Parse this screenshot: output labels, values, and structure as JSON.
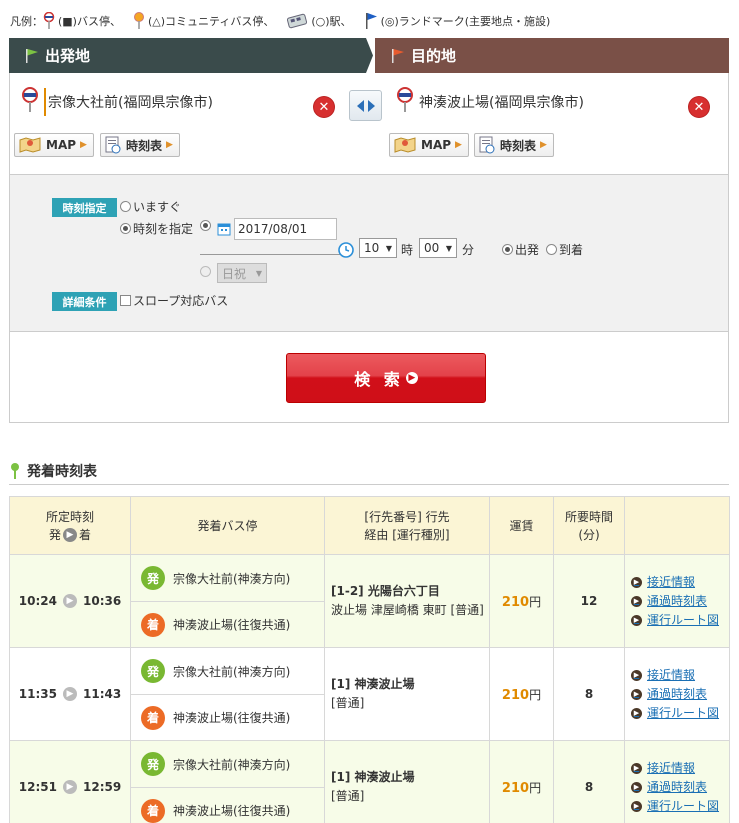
{
  "legend": {
    "prefix": "凡例：",
    "items": [
      {
        "label": "(■)バス停、",
        "icon": "bus-stop-icon"
      },
      {
        "label": "(△)コミュニティバス停、",
        "icon": "community-bus-stop-icon"
      },
      {
        "label": "(○)駅、",
        "icon": "station-icon"
      },
      {
        "label": "(◎)ランドマーク(主要地点・施設)",
        "icon": "landmark-flag-icon"
      }
    ]
  },
  "departure": {
    "header": "出発地",
    "stop_name": "宗像大社前(福岡県宗像市)",
    "map_label": "MAP",
    "timetable_label": "時刻表"
  },
  "arrival": {
    "header": "目的地",
    "stop_name": "神湊波止場(福岡県宗像市)",
    "map_label": "MAP",
    "timetable_label": "時刻表"
  },
  "options": {
    "time_tag": "時刻指定",
    "now_label": "いますぐ",
    "specify_label": "時刻を指定",
    "date_value": "2017/08/01",
    "hour_value": "10",
    "hour_unit": "時",
    "minute_value": "00",
    "minute_unit": "分",
    "depart_label": "出発",
    "arrive_label": "到着",
    "daytype_value": "日祝",
    "detail_tag": "詳細条件",
    "slope_label": "スロープ対応バス"
  },
  "search": {
    "label": "検 索"
  },
  "timetable": {
    "section_title": "発着時刻表",
    "headers": {
      "time_line1": "所定時刻",
      "time_dep": "発",
      "time_arr": "着",
      "stops": "発着バス停",
      "route_line1": "[行先番号] 行先",
      "route_line2": "経由 [運行種別]",
      "fare": "運賃",
      "duration_line1": "所要時間",
      "duration_line2": "(分)"
    },
    "rows": [
      {
        "dep_time": "10:24",
        "arr_time": "10:36",
        "dep_badge": "発",
        "dep_stop": "宗像大社前(神湊方向)",
        "arr_badge": "着",
        "arr_stop": "神湊波止場(往復共通)",
        "route_title": "[1-2] 光陽台六丁目",
        "route_sub": "波止場 津屋崎橋 東町 [普通]",
        "fare": "210",
        "fare_unit": "円",
        "minutes": "12",
        "link1": "接近情報",
        "link2": "通過時刻表",
        "link3": "運行ルート図"
      },
      {
        "dep_time": "11:35",
        "arr_time": "11:43",
        "dep_badge": "発",
        "dep_stop": "宗像大社前(神湊方向)",
        "arr_badge": "着",
        "arr_stop": "神湊波止場(往復共通)",
        "route_title": "[1] 神湊波止場",
        "route_sub": "[普通]",
        "fare": "210",
        "fare_unit": "円",
        "minutes": "8",
        "link1": "接近情報",
        "link2": "通過時刻表",
        "link3": "運行ルート図"
      },
      {
        "dep_time": "12:51",
        "arr_time": "12:59",
        "dep_badge": "発",
        "dep_stop": "宗像大社前(神湊方向)",
        "arr_badge": "着",
        "arr_stop": "神湊波止場(往復共通)",
        "route_title": "[1] 神湊波止場",
        "route_sub": "[普通]",
        "fare": "210",
        "fare_unit": "円",
        "minutes": "8",
        "link1": "接近情報",
        "link2": "通過時刻表",
        "link3": "運行ルート図"
      }
    ]
  },
  "colors": {
    "dep_header": "#3a4b4b",
    "arr_header": "#7a5047",
    "tag": "#2ea2b5",
    "search_red": "#d10f19",
    "accent_orange": "#e08a00",
    "link_blue": "#1a6fb4"
  }
}
